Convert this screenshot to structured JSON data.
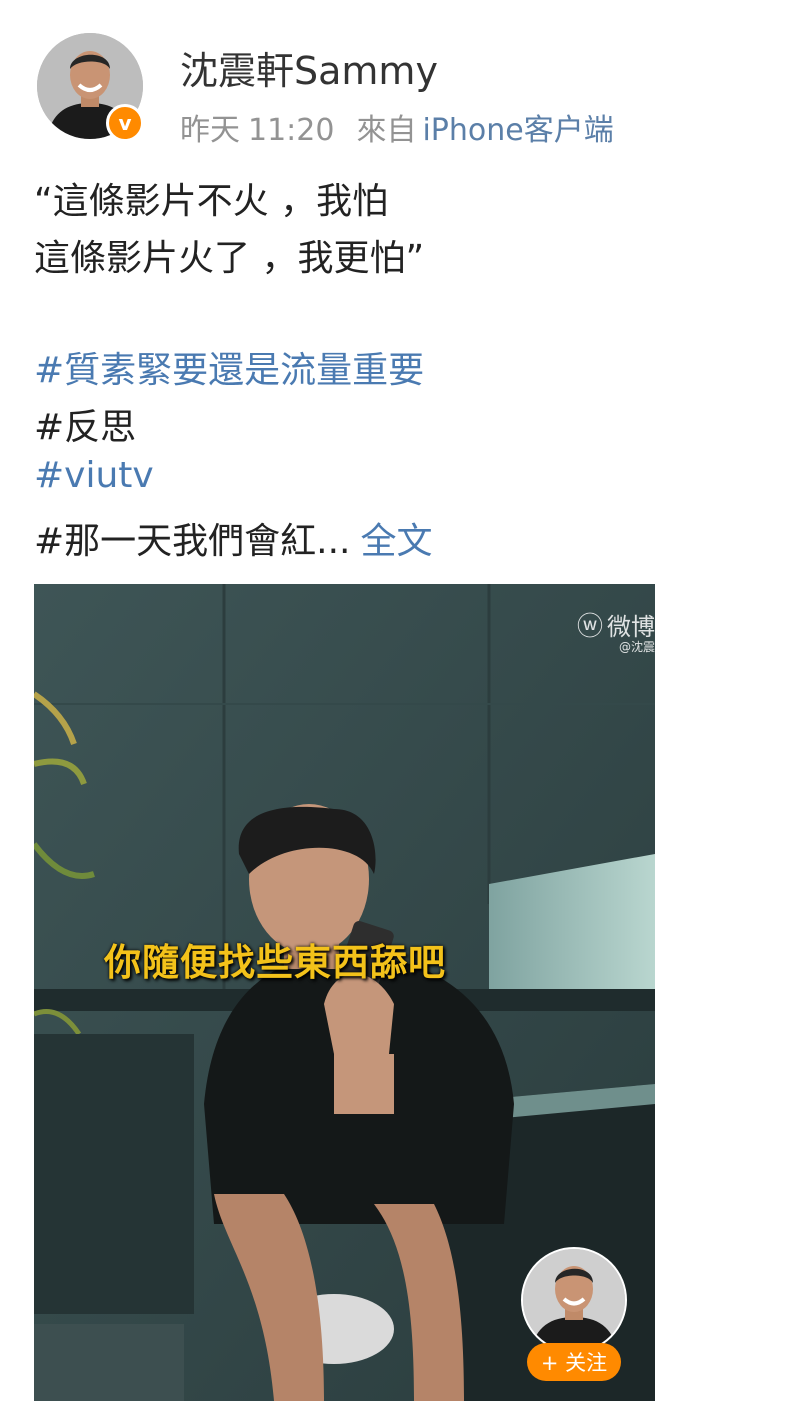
{
  "post": {
    "username": "沈震軒Sammy",
    "date": "昨天",
    "time": "11:20",
    "from_label": "來自",
    "client": "iPhone客户端",
    "verified_mark": "v",
    "lines": [
      "“這條影片不火 ，我怕",
      "這條影片火了 ，我更怕”"
    ],
    "tags": [
      "#質素緊要還是流量重要",
      "#反思",
      "#viutv",
      "#那一天我們會紅..."
    ],
    "full_text_link": "全文"
  },
  "video": {
    "subtitle": "你隨便找些東西舔吧",
    "watermark": "微博",
    "watermark_sub": "@沈震"
  },
  "follow": {
    "label": "+ 关注"
  },
  "colors": {
    "link": "#4a7ab1",
    "accent": "#ff8a00",
    "meta": "#939393",
    "subtitle": "#f3c21a"
  }
}
